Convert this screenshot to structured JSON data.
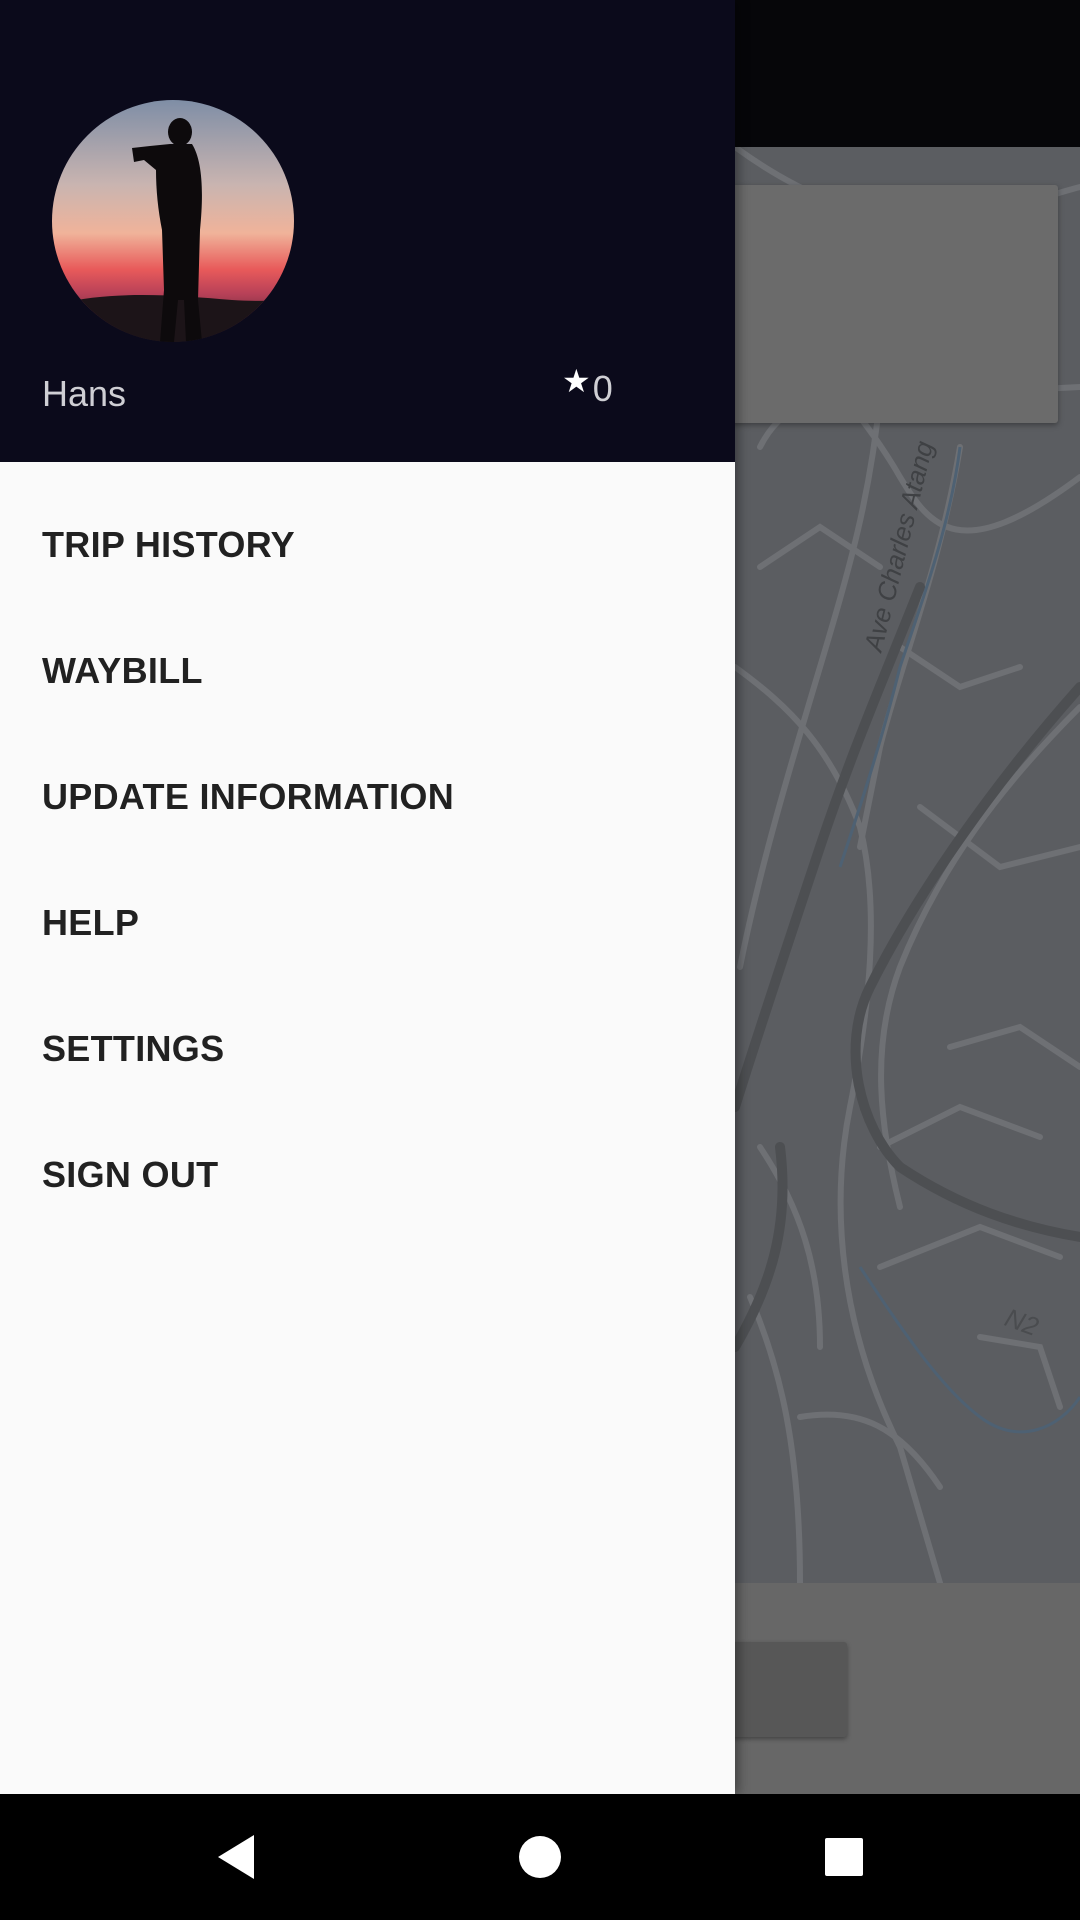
{
  "drawer": {
    "user_name": "Hans",
    "rating_icon": "star-icon",
    "rating": "0",
    "menu": [
      {
        "label": "TRIP HISTORY"
      },
      {
        "label": "WAYBILL"
      },
      {
        "label": "UPDATE INFORMATION"
      },
      {
        "label": "HELP"
      },
      {
        "label": "SETTINGS"
      },
      {
        "label": "SIGN OUT"
      }
    ]
  },
  "map": {
    "road_label": "Ave Charles Atang",
    "route_label": "N2"
  },
  "navbar": {
    "back_icon": "back-triangle-icon",
    "home_icon": "home-circle-icon",
    "recents_icon": "recents-square-icon"
  },
  "colors": {
    "drawer_header": "#0b0a1b",
    "drawer_body": "#fafafa",
    "menu_text": "#212121",
    "scrim_map": "#5b5d61"
  }
}
